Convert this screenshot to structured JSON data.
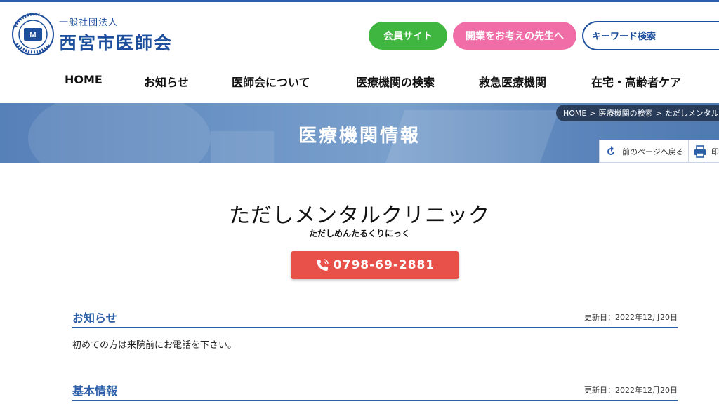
{
  "header": {
    "logo_sub": "一般社団法人",
    "logo_main": "西宮市医師会",
    "logo_ring_text": "NISHINOMIYA MEDICAL ASSOCIATION",
    "member_button": "会員サイト",
    "open_button": "開業をお考えの先生へ",
    "search_placeholder": "キーワード検索"
  },
  "nav": {
    "items": [
      "HOME",
      "お知らせ",
      "医師会について",
      "医療機関の検索",
      "救急医療機関",
      "在宅・高齢者ケア"
    ]
  },
  "banner": {
    "title": "医療機関情報",
    "breadcrumb": [
      "HOME",
      ">",
      "医療機関の検索",
      ">",
      "ただしメンタルクリ"
    ],
    "back_label": "前のページへ戻る",
    "print_label": "印"
  },
  "clinic": {
    "name": "ただしメンタルクリニック",
    "kana": "ただしめんたるくりにっく",
    "phone": "0798-69-2881"
  },
  "sections": [
    {
      "title": "お知らせ",
      "date": "更新日：2022年12月20日",
      "body": "初めての方は来院前にお電話を下さい。"
    },
    {
      "title": "基本情報",
      "date": "更新日：2022年12月20日"
    }
  ],
  "colors": {
    "brand": "#1d4f9c",
    "member_green": "#3fb63f",
    "open_pink": "#f06da7",
    "phone_red": "#e8504a"
  }
}
